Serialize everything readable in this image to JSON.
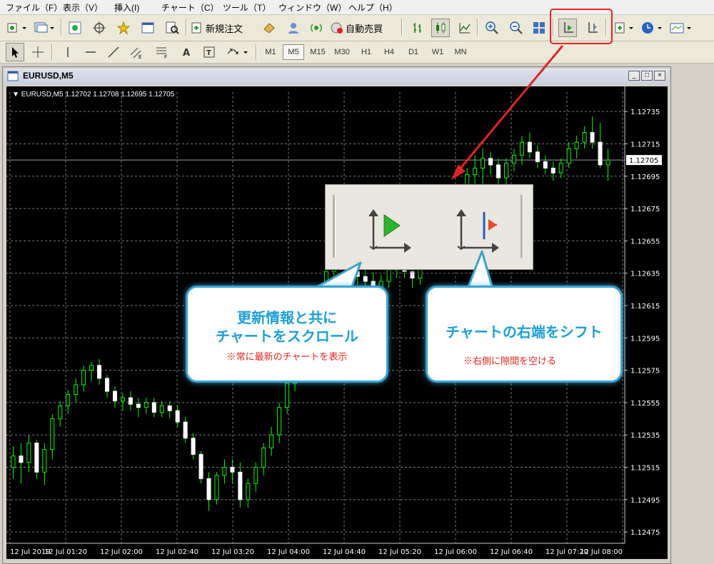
{
  "menu": [
    "ファイル（F）",
    "表示（V）",
    "挿入(I)",
    "チャート（C）",
    "ツール（T）",
    "ウィンドウ（W）",
    "ヘルプ（H）"
  ],
  "toolbar": {
    "new_order_label": "新規注文",
    "auto_trade_label": "自動売買"
  },
  "timeframes": [
    "M1",
    "M5",
    "M15",
    "M30",
    "H1",
    "H4",
    "D1",
    "W1",
    "MN"
  ],
  "active_timeframe": "M5",
  "window": {
    "title": "EURUSD,M5"
  },
  "chart_info": "EURUSD,M5  1.12702 1.12708 1.12695 1.12705",
  "current_price_label": "1.12705",
  "callouts": {
    "left": {
      "line1": "更新情報と共に",
      "line2": "チャートをスクロール",
      "note": "※常に最新のチャートを表示"
    },
    "right": {
      "line1": "チャートの右端をシフト",
      "note": "※右側に隙間を空ける"
    }
  },
  "colors": {
    "accent": "#1aa0d8",
    "note": "#e8241c",
    "highlight": "#e52222",
    "bull": "#00ff00",
    "chart_bg": "#000000"
  },
  "chart_data": {
    "type": "candlestick",
    "symbol": "EURUSD",
    "timeframe": "M5",
    "y_ticks": [
      1.12735,
      1.12715,
      1.12695,
      1.12675,
      1.12655,
      1.12635,
      1.12615,
      1.12595,
      1.12575,
      1.12555,
      1.12535,
      1.12515,
      1.12495,
      1.12475
    ],
    "x_ticks": [
      "12 Jul 2019",
      "12 Jul 01:20",
      "12 Jul 02:00",
      "12 Jul 02:40",
      "12 Jul 03:20",
      "12 Jul 04:00",
      "12 Jul 04:40",
      "12 Jul 05:20",
      "12 Jul 06:00",
      "12 Jul 06:40",
      "12 Jul 07:20",
      "12 Jul 08:00"
    ],
    "ylim": [
      1.12468,
      1.12747
    ],
    "current_price": 1.12705,
    "grid": true,
    "candles": [
      [
        1.12515,
        1.12528,
        1.12508,
        1.12522
      ],
      [
        1.12522,
        1.1253,
        1.12505,
        1.12518
      ],
      [
        1.12518,
        1.12535,
        1.12512,
        1.1253
      ],
      [
        1.1253,
        1.12532,
        1.12508,
        1.12512
      ],
      [
        1.12512,
        1.1253,
        1.12504,
        1.12526
      ],
      [
        1.12526,
        1.12548,
        1.1252,
        1.12545
      ],
      [
        1.12545,
        1.12556,
        1.1254,
        1.12553
      ],
      [
        1.12553,
        1.12563,
        1.12548,
        1.1256
      ],
      [
        1.1256,
        1.1257,
        1.12555,
        1.12566
      ],
      [
        1.12566,
        1.12578,
        1.12562,
        1.12575
      ],
      [
        1.12575,
        1.1258,
        1.12568,
        1.12578
      ],
      [
        1.12578,
        1.12582,
        1.12566,
        1.1257
      ],
      [
        1.1257,
        1.12572,
        1.12558,
        1.12562
      ],
      [
        1.12562,
        1.12565,
        1.12552,
        1.12556
      ],
      [
        1.12556,
        1.12561,
        1.1255,
        1.12558
      ],
      [
        1.12558,
        1.12562,
        1.1255,
        1.12554
      ],
      [
        1.12554,
        1.12558,
        1.12546,
        1.12552
      ],
      [
        1.12552,
        1.12558,
        1.12548,
        1.12555
      ],
      [
        1.12555,
        1.12558,
        1.12546,
        1.12549
      ],
      [
        1.12549,
        1.12556,
        1.12546,
        1.12553
      ],
      [
        1.12553,
        1.12556,
        1.12545,
        1.1255
      ],
      [
        1.1255,
        1.12553,
        1.1254,
        1.12543
      ],
      [
        1.12543,
        1.12546,
        1.1253,
        1.12533
      ],
      [
        1.12533,
        1.12536,
        1.1252,
        1.12523
      ],
      [
        1.12523,
        1.12525,
        1.12505,
        1.12508
      ],
      [
        1.12508,
        1.12512,
        1.12488,
        1.12495
      ],
      [
        1.12495,
        1.12512,
        1.12492,
        1.1251
      ],
      [
        1.1251,
        1.1252,
        1.12505,
        1.12515
      ],
      [
        1.12515,
        1.1252,
        1.12505,
        1.12512
      ],
      [
        1.12512,
        1.12518,
        1.1249,
        1.12495
      ],
      [
        1.12495,
        1.12508,
        1.1249,
        1.12505
      ],
      [
        1.12505,
        1.12518,
        1.125,
        1.12515
      ],
      [
        1.12515,
        1.1253,
        1.1251,
        1.12527
      ],
      [
        1.12527,
        1.1254,
        1.12522,
        1.12535
      ],
      [
        1.12535,
        1.12555,
        1.1253,
        1.12552
      ],
      [
        1.12552,
        1.1257,
        1.12548,
        1.12567
      ],
      [
        1.12567,
        1.12585,
        1.12562,
        1.12582
      ],
      [
        1.12582,
        1.126,
        1.12578,
        1.12597
      ],
      [
        1.12597,
        1.12615,
        1.12592,
        1.1261
      ],
      [
        1.1261,
        1.12628,
        1.12605,
        1.12624
      ],
      [
        1.12624,
        1.1264,
        1.12618,
        1.12636
      ],
      [
        1.12636,
        1.1265,
        1.1263,
        1.12646
      ],
      [
        1.12646,
        1.12656,
        1.12638,
        1.12642
      ],
      [
        1.12642,
        1.12648,
        1.12632,
        1.12636
      ],
      [
        1.12636,
        1.12642,
        1.12628,
        1.12633
      ],
      [
        1.12633,
        1.1264,
        1.12626,
        1.1263
      ],
      [
        1.1263,
        1.12636,
        1.1262,
        1.12626
      ],
      [
        1.12626,
        1.12634,
        1.12618,
        1.1263
      ],
      [
        1.1263,
        1.1264,
        1.12626,
        1.12637
      ],
      [
        1.12637,
        1.12648,
        1.12632,
        1.12644
      ],
      [
        1.12644,
        1.1265,
        1.12632,
        1.12636
      ],
      [
        1.12636,
        1.12642,
        1.12626,
        1.12632
      ],
      [
        1.12632,
        1.12645,
        1.12628,
        1.12642
      ],
      [
        1.12642,
        1.12655,
        1.12638,
        1.1265
      ],
      [
        1.1265,
        1.12662,
        1.12644,
        1.12658
      ],
      [
        1.12658,
        1.12672,
        1.12652,
        1.12668
      ],
      [
        1.12668,
        1.12682,
        1.12662,
        1.12678
      ],
      [
        1.12678,
        1.1269,
        1.12672,
        1.12685
      ],
      [
        1.12685,
        1.127,
        1.1268,
        1.12696
      ],
      [
        1.12696,
        1.12708,
        1.12688,
        1.127
      ],
      [
        1.127,
        1.12712,
        1.1269,
        1.12706
      ],
      [
        1.12706,
        1.1271,
        1.12696,
        1.12702
      ],
      [
        1.12702,
        1.12706,
        1.1269,
        1.12694
      ],
      [
        1.12694,
        1.12706,
        1.1269,
        1.12703
      ],
      [
        1.12703,
        1.12712,
        1.12698,
        1.12708
      ],
      [
        1.12708,
        1.1272,
        1.12702,
        1.12716
      ],
      [
        1.12716,
        1.12722,
        1.12706,
        1.1271
      ],
      [
        1.1271,
        1.12714,
        1.127,
        1.12704
      ],
      [
        1.12704,
        1.12708,
        1.12696,
        1.127
      ],
      [
        1.127,
        1.12704,
        1.12692,
        1.12697
      ],
      [
        1.12697,
        1.12706,
        1.12694,
        1.12703
      ],
      [
        1.12703,
        1.12716,
        1.127,
        1.12712
      ],
      [
        1.12712,
        1.1272,
        1.12706,
        1.12716
      ],
      [
        1.12716,
        1.12726,
        1.12712,
        1.12722
      ],
      [
        1.12722,
        1.12732,
        1.12712,
        1.12716
      ],
      [
        1.12716,
        1.12728,
        1.127,
        1.12702
      ],
      [
        1.12702,
        1.12712,
        1.12692,
        1.12705
      ]
    ]
  }
}
